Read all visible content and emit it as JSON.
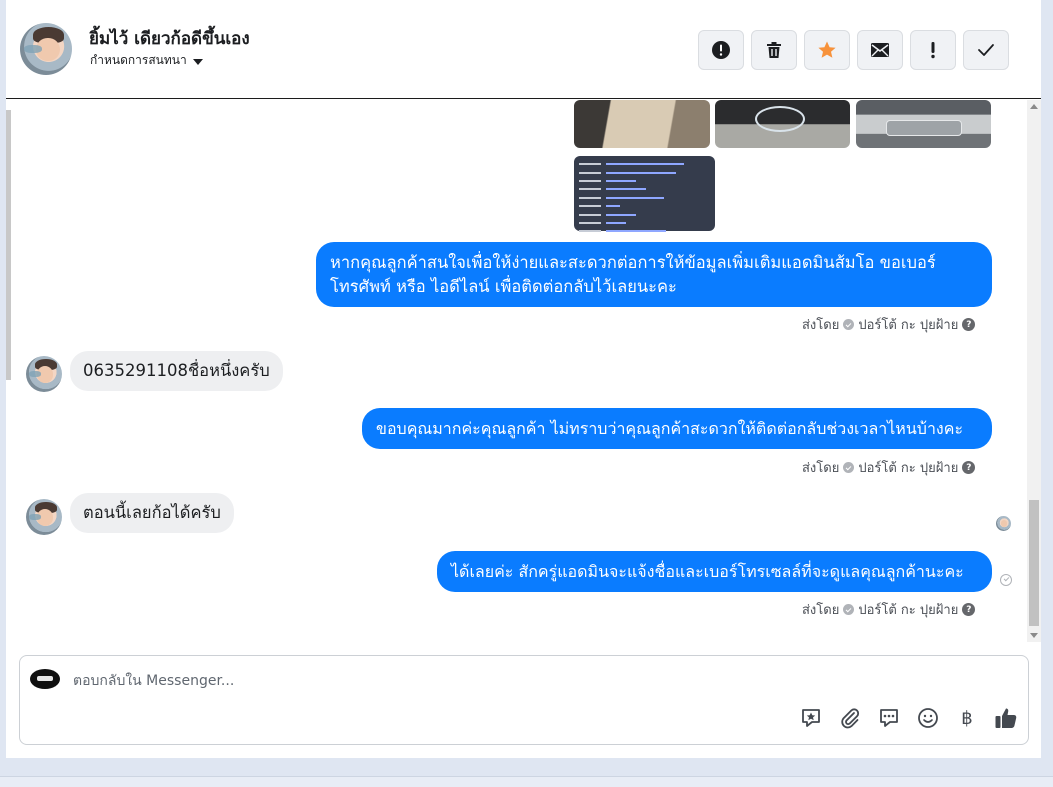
{
  "header": {
    "contact_name": "ยิ้มไว้ เดียวก้อดีขึ้นเอง",
    "assign_label": "กำหนดการสนทนา",
    "toolbar": [
      {
        "name": "report-spam-button",
        "icon": "alert-circle-icon"
      },
      {
        "name": "delete-button",
        "icon": "trash-icon"
      },
      {
        "name": "star-button",
        "icon": "star-icon"
      },
      {
        "name": "mark-unread-button",
        "icon": "envelope-icon"
      },
      {
        "name": "flag-button",
        "icon": "exclamation-icon"
      },
      {
        "name": "mark-done-button",
        "icon": "checkmark-icon"
      }
    ]
  },
  "messages": [
    {
      "type": "media",
      "items": [
        "photo-interior",
        "photo-dashboard",
        "photo-engine",
        "photo-spec-sheet"
      ]
    },
    {
      "type": "outgoing",
      "text_line1": "หากคุณลูกค้าสนใจเพื่อให้ง่ายและสะดวกต่อการให้ข้อมูลเพิ่มเติมแอดมินส้มโอ ขอเบอร์",
      "text_line2": "โทรศัพท์ หรือ ไอดีไลน์ เพื่อติดต่อกลับไว้เลยนะคะ",
      "sender_prefix": "ส่งโดย",
      "sender_name": "ปอร์โต้ กะ ปุยฝ้าย"
    },
    {
      "type": "incoming",
      "text": "0635291108ชื่อหนึ่งครับ"
    },
    {
      "type": "outgoing",
      "text": "ขอบคุณมากค่ะคุณลูกค้า ไม่ทราบว่าคุณลูกค้าสะดวกให้ติดต่อกลับช่วงเวลาไหนบ้างคะ",
      "sender_prefix": "ส่งโดย",
      "sender_name": "ปอร์โต้ กะ ปุยฝ้าย"
    },
    {
      "type": "incoming",
      "text": "ตอนนี้เลยก้อได้ครับ"
    },
    {
      "type": "outgoing",
      "text": "ได้เลยค่ะ สักครู่แอดมินจะแจ้งชื่อและเบอร์โทรเซลล์ที่จะดูแลคุณลูกค้านะคะ",
      "sender_prefix": "ส่งโดย",
      "sender_name": "ปอร์โต้ กะ ปุยฝ้าย"
    }
  ],
  "composer": {
    "placeholder": "ตอบกลับใน Messenger...",
    "value": "",
    "tools": [
      "sticker-icon",
      "attachment-icon",
      "saved-replies-icon",
      "emoji-icon",
      "baht-icon",
      "thumbs-up-icon"
    ],
    "baht_symbol": "฿"
  },
  "colors": {
    "outgoing_bubble": "#0a7cff",
    "incoming_bubble": "#eeeff1",
    "star": "#f7923b"
  }
}
